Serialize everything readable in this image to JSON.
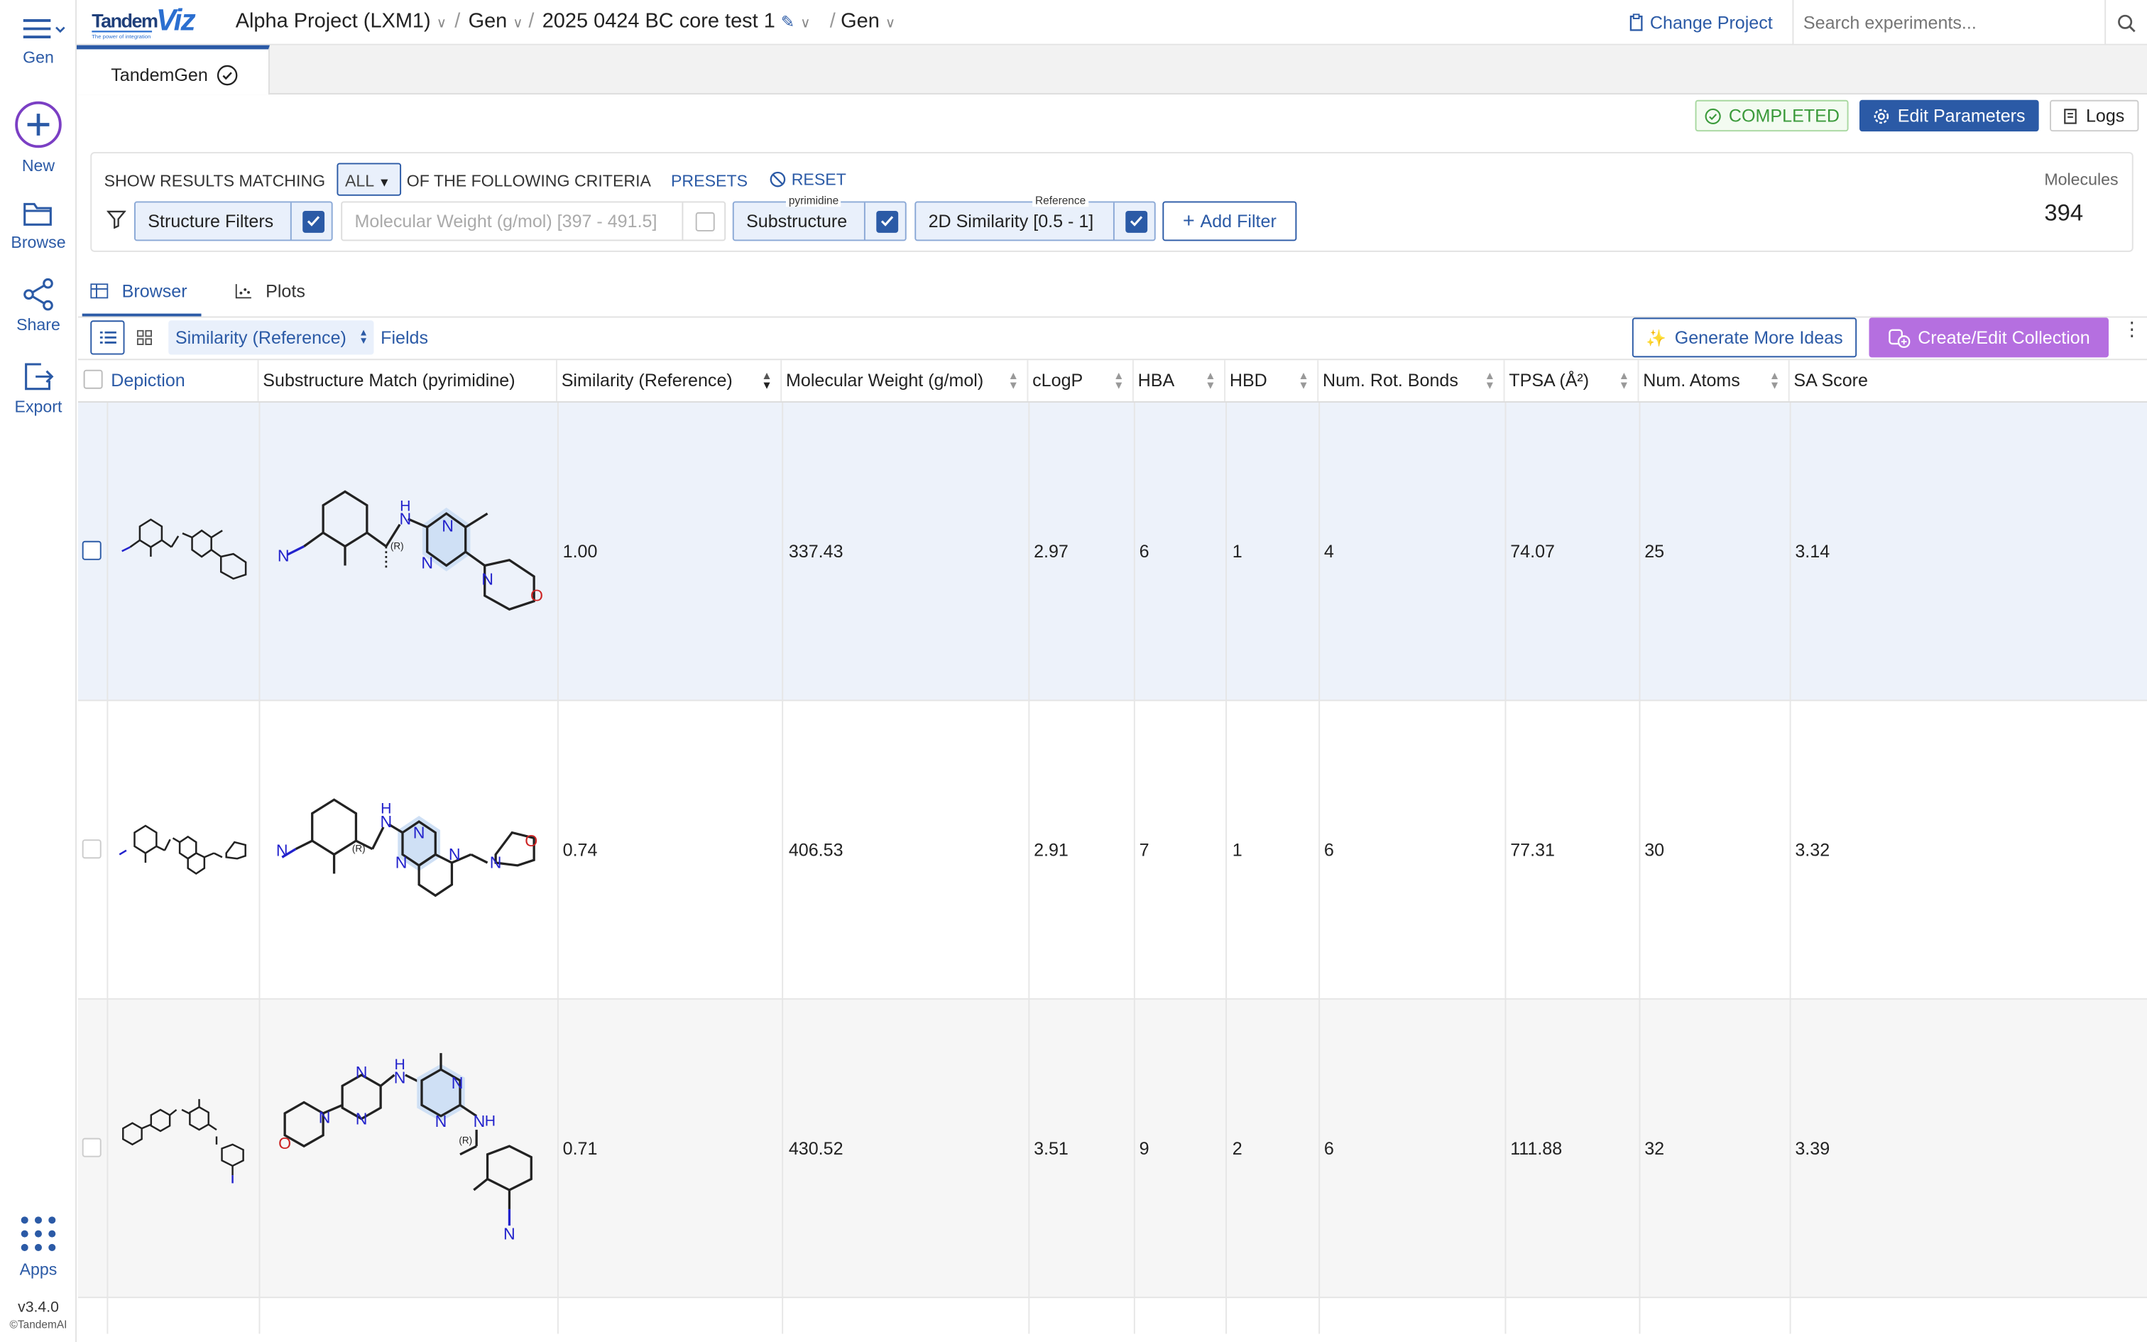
{
  "app": {
    "logo_text": "TandemViz",
    "logo_tagline": "The power of integration",
    "version": "v3.4.0",
    "copyright": "©TandemAI"
  },
  "rail": {
    "menu_label": "Gen",
    "items": [
      {
        "label": "New",
        "icon": "plus-circle-icon"
      },
      {
        "label": "Browse",
        "icon": "folder-icon"
      },
      {
        "label": "Share",
        "icon": "share-icon"
      },
      {
        "label": "Export",
        "icon": "export-icon"
      },
      {
        "label": "Apps",
        "icon": "apps-grid-icon"
      }
    ]
  },
  "breadcrumb": {
    "project": "Alpha Project (LXM1)",
    "module": "Gen",
    "experiment": "2025 0424 BC core test 1",
    "view": "Gen",
    "separator": "/"
  },
  "header": {
    "change_project": "Change Project",
    "search_placeholder": "Search experiments..."
  },
  "tabs": [
    {
      "label": "TandemGen",
      "status": "completed"
    }
  ],
  "status": {
    "badge": "COMPLETED",
    "edit_parameters": "Edit Parameters",
    "logs": "Logs"
  },
  "criteria": {
    "prefix": "SHOW RESULTS MATCHING",
    "mode": "ALL",
    "suffix": "OF THE FOLLOWING CRITERIA",
    "presets": "PRESETS",
    "reset": "RESET"
  },
  "filters": {
    "structure_filters": {
      "label": "Structure Filters",
      "checked": true
    },
    "molecular_weight": {
      "label": "Molecular Weight (g/mol) [397 - 491.5]",
      "checked": false
    },
    "substructure": {
      "label": "Substructure",
      "tag": "pyrimidine",
      "checked": true
    },
    "similarity": {
      "label": "2D Similarity [0.5 - 1]",
      "tag": "Reference",
      "checked": true
    },
    "add_filter": "Add Filter"
  },
  "molecules": {
    "label": "Molecules",
    "count": "394"
  },
  "view_tabs": [
    {
      "label": "Browser",
      "active": true
    },
    {
      "label": "Plots",
      "active": false
    }
  ],
  "toolbar": {
    "sort_field": "Similarity (Reference)",
    "fields": "Fields",
    "generate": "Generate More Ideas",
    "collection": "Create/Edit Collection"
  },
  "table": {
    "columns": [
      "Depiction",
      "Substructure Match (pyrimidine)",
      "Similarity (Reference)",
      "Molecular Weight (g/mol)",
      "cLogP",
      "HBA",
      "HBD",
      "Num. Rot. Bonds",
      "TPSA (Å²)",
      "Num. Atoms",
      "SA Score"
    ],
    "rows": [
      {
        "similarity": "1.00",
        "mw": "337.43",
        "clogp": "2.97",
        "hba": "6",
        "hbd": "1",
        "rot": "4",
        "tpsa": "74.07",
        "atoms": "25",
        "sa": "3.14",
        "selected": true
      },
      {
        "similarity": "0.74",
        "mw": "406.53",
        "clogp": "2.91",
        "hba": "7",
        "hbd": "1",
        "rot": "6",
        "tpsa": "77.31",
        "atoms": "30",
        "sa": "3.32",
        "selected": false
      },
      {
        "similarity": "0.71",
        "mw": "430.52",
        "clogp": "3.51",
        "hba": "9",
        "hbd": "2",
        "rot": "6",
        "tpsa": "111.88",
        "atoms": "32",
        "sa": "3.39",
        "selected": false
      }
    ]
  },
  "structure_labels": {
    "n": "N",
    "nh": "H",
    "o": "O",
    "stereo": "(R)"
  },
  "colors": {
    "primary": "#2b5aa6",
    "success": "#3a9a3a",
    "collection": "#b56fe0",
    "highlight": "#cfe0f5"
  }
}
